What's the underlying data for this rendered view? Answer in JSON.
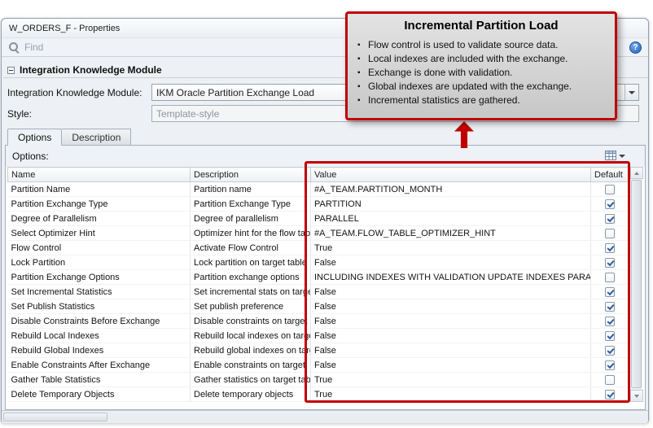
{
  "window": {
    "title": "W_ORDERS_F - Properties"
  },
  "find": {
    "placeholder": "Find"
  },
  "help": {
    "glyph": "?"
  },
  "section": {
    "title": "Integration Knowledge Module"
  },
  "fields": {
    "ikm_label": "Integration Knowledge Module:",
    "ikm_value": "IKM Oracle Partition Exchange Load",
    "style_label": "Style:",
    "style_value": "Template-style"
  },
  "tabs": [
    {
      "label": "Options",
      "active": true
    },
    {
      "label": "Description",
      "active": false
    }
  ],
  "options_panel": {
    "label": "Options:"
  },
  "table": {
    "columns": [
      "Name",
      "Description",
      "Value",
      "Default"
    ],
    "rows": [
      {
        "name": "Partition Name",
        "description": "Partition name",
        "value": "#A_TEAM.PARTITION_MONTH",
        "default": false
      },
      {
        "name": "Partition Exchange Type",
        "description": "Partition Exchange Type",
        "value": "PARTITION",
        "default": true
      },
      {
        "name": "Degree of Parallelism",
        "description": "Degree of parallelism",
        "value": "PARALLEL",
        "default": true
      },
      {
        "name": "Select Optimizer Hint",
        "description": "Optimizer hint for the flow table",
        "value": "#A_TEAM.FLOW_TABLE_OPTIMIZER_HINT",
        "default": false
      },
      {
        "name": "Flow Control",
        "description": "Activate Flow Control",
        "value": "True",
        "default": true
      },
      {
        "name": "Lock Partition",
        "description": "Lock partition on target table",
        "value": "False",
        "default": true
      },
      {
        "name": "Partition Exchange Options",
        "description": "Partition exchange options",
        "value": "INCLUDING INDEXES WITH VALIDATION UPDATE INDEXES PARALLEL",
        "default": false
      },
      {
        "name": "Set Incremental Statistics",
        "description": "Set incremental stats on target",
        "value": "False",
        "default": true
      },
      {
        "name": "Set Publish Statistics",
        "description": "Set publish preference",
        "value": "False",
        "default": true
      },
      {
        "name": "Disable Constraints Before Exchange",
        "description": "Disable constraints on target",
        "value": "False",
        "default": true
      },
      {
        "name": "Rebuild Local Indexes",
        "description": "Rebuild local indexes on target",
        "value": "False",
        "default": true
      },
      {
        "name": "Rebuild Global Indexes",
        "description": "Rebuild global indexes on target",
        "value": "False",
        "default": true
      },
      {
        "name": "Enable Constraints After Exchange",
        "description": "Enable constraints on target",
        "value": "False",
        "default": true
      },
      {
        "name": "Gather Table Statistics",
        "description": "Gather statistics on target table",
        "value": "True",
        "default": false
      },
      {
        "name": "Delete Temporary Objects",
        "description": "Delete temporary objects",
        "value": "True",
        "default": true
      }
    ]
  },
  "callout": {
    "title": "Incremental Partition Load",
    "bullets": [
      "Flow control is used to validate source data.",
      "Local indexes are included with the exchange.",
      "Exchange is done with validation.",
      "Global indexes are updated with the exchange.",
      "Incremental statistics are gathered."
    ]
  },
  "colors": {
    "annotation_red": "#C00000",
    "check_blue": "#2F5E9E",
    "help_blue": "#2263BC"
  }
}
